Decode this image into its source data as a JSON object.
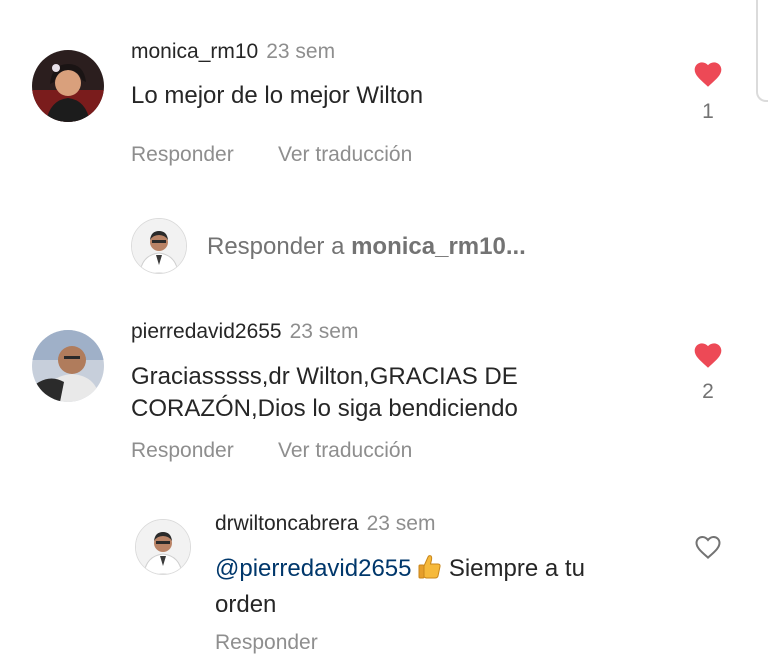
{
  "comments": [
    {
      "username": "monica_rm10",
      "time": "23 sem",
      "text": "Lo mejor de lo mejor Wilton",
      "likes": "1",
      "liked": true,
      "actions": {
        "reply": "Responder",
        "translate": "Ver traducción"
      }
    },
    {
      "username": "pierredavid2655",
      "time": "23 sem",
      "text_line1": "Graciasssss,dr Wilton,GRACIAS DE",
      "text_line2": "CORAZÓN,Dios lo siga bendiciendo",
      "likes": "2",
      "liked": true,
      "actions": {
        "reply": "Responder",
        "translate": "Ver traducción"
      }
    }
  ],
  "reply_box": {
    "prefix": "Responder a ",
    "target": "monica_rm10..."
  },
  "reply": {
    "username": "drwiltoncabrera",
    "time": "23 sem",
    "mention": "@pierredavid2655",
    "emoji": "thumbs-up",
    "text_line1": "Siempre a tu",
    "text_line2": "orden",
    "liked": false,
    "actions": {
      "reply": "Responder"
    }
  },
  "colors": {
    "heart_liked": "#ed4956",
    "secondary_text": "#8e8e8e",
    "mention": "#00376b"
  }
}
